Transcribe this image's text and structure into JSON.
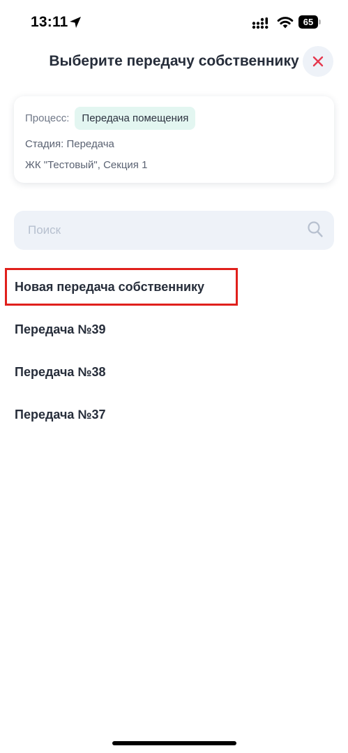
{
  "status_bar": {
    "time": "13:11",
    "battery_level": "65"
  },
  "header": {
    "title": "Выберите передачу собственнику",
    "close_icon": "close-icon",
    "close_color": "#e5384e"
  },
  "info_card": {
    "process_label": "Процесс:",
    "process_value": "Передача помещения",
    "stage": "Стадия: Передача",
    "object": "ЖК \"Тестовый\", Секция 1"
  },
  "search": {
    "placeholder": "Поиск",
    "value": ""
  },
  "list": {
    "items": [
      {
        "label": "Новая передача собственнику"
      },
      {
        "label": "Передача №39"
      },
      {
        "label": "Передача №38"
      },
      {
        "label": "Передача №37"
      }
    ],
    "highlighted_item_color": "#e0201c"
  }
}
